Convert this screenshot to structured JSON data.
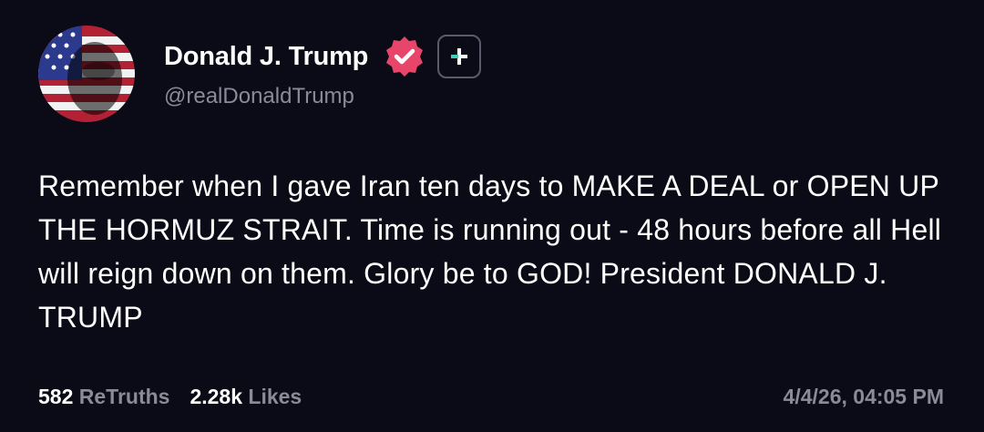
{
  "author": {
    "display_name": "Donald J. Trump",
    "handle": "@realDonaldTrump",
    "avatar_icon": "flag-portrait-avatar",
    "verified_icon": "verified-badge-icon",
    "verified_color": "#e8456b",
    "follow_icon": "plus-icon",
    "follow_accent": "#3fd0b8"
  },
  "post": {
    "text": "Remember when I gave Iran ten days to MAKE A DEAL or OPEN UP THE HORMUZ STRAIT. Time is running out - 48 hours before all Hell will reign down on them. Glory be to GOD! President DONALD J. TRUMP"
  },
  "stats": {
    "retruths_count": "582",
    "retruths_label": "ReTruths",
    "likes_count": "2.28k",
    "likes_label": "Likes"
  },
  "timestamp": "4/4/26, 04:05 PM"
}
